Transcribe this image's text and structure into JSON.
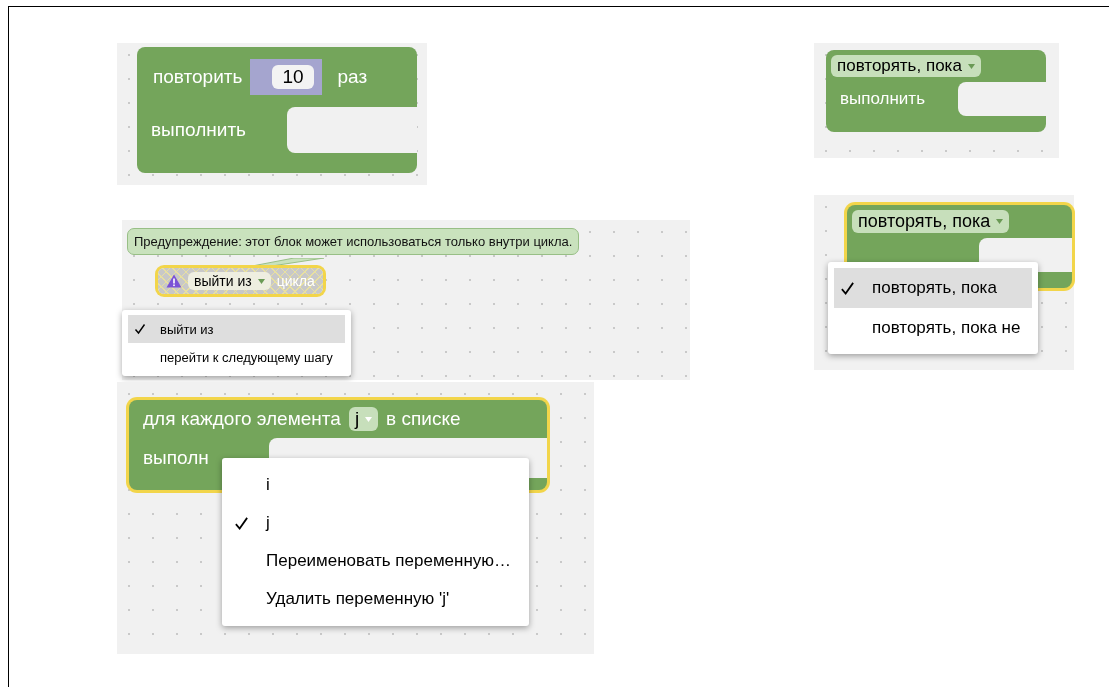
{
  "left_panels": [
    {
      "kind": "repeat",
      "selected": false,
      "disabled": false,
      "label": "повторить",
      "value": "10",
      "suffix": "раз",
      "do_label": "выполнить"
    },
    {
      "kind": "break",
      "selected": true,
      "disabled": true,
      "warning": "Предупреждение: этот блок может использоваться только внутри цикла.",
      "field": "выйти из",
      "suffix": "цикла",
      "menu": [
        {
          "label": "выйти из",
          "selected": true,
          "highlighted": true
        },
        {
          "label": "перейти к следующему шагу",
          "selected": false,
          "highlighted": false
        }
      ]
    },
    {
      "kind": "foreach",
      "selected": true,
      "disabled": false,
      "label": "для каждого элемента",
      "field": "j",
      "suffix": "в списке",
      "do_label": "выполн",
      "menu": [
        {
          "label": "i",
          "selected": false,
          "highlighted": false
        },
        {
          "label": "j",
          "selected": true,
          "highlighted": false
        },
        {
          "label": "Переименовать переменную…",
          "selected": false,
          "highlighted": false
        },
        {
          "label": "Удалить переменную 'j'",
          "selected": false,
          "highlighted": false
        }
      ]
    }
  ],
  "right_panels": [
    {
      "kind": "while",
      "selected": false,
      "disabled": false,
      "field": "повторять, пока",
      "do_label": "выполнить"
    },
    {
      "kind": "while",
      "selected": true,
      "disabled": false,
      "field": "повторять, пока",
      "menu": [
        {
          "label": "повторять, пока",
          "selected": true,
          "highlighted": true
        },
        {
          "label": "повторять, пока не",
          "selected": false,
          "highlighted": false
        }
      ]
    }
  ]
}
